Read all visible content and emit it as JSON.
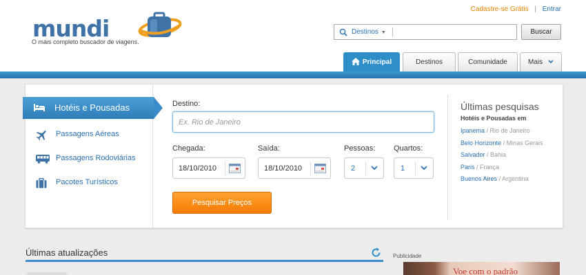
{
  "brand": {
    "name": "mundi",
    "tagline": "O mais completo buscador de viagens.",
    "color": "#3f72a6"
  },
  "toplinks": {
    "signup": "Cadastre-se Grátis",
    "separator": "|",
    "login": "Entrar"
  },
  "search": {
    "dropdown": "Destinos",
    "button": "Buscar"
  },
  "tabs": [
    {
      "label": "Principal",
      "active": true
    },
    {
      "label": "Destinos"
    },
    {
      "label": "Comunidade"
    },
    {
      "label": "Mais"
    }
  ],
  "categories": [
    {
      "label": "Hotéis e Pousadas",
      "icon": "bed-icon",
      "active": true
    },
    {
      "label": "Passagens Aéreas",
      "icon": "airplane-icon"
    },
    {
      "label": "Passagens Rodoviárias",
      "icon": "bus-icon"
    },
    {
      "label": "Pacotes Turísticos",
      "icon": "suitcase-icon"
    }
  ],
  "form": {
    "destino_label": "Destino:",
    "destino_placeholder": "Ex. Rio de Janeiro",
    "chegada_label": "Chegada:",
    "chegada_value": "18/10/2010",
    "saida_label": "Saída:",
    "saida_value": "18/10/2010",
    "pessoas_label": "Pessoas:",
    "pessoas_value": "2",
    "quartos_label": "Quartos:",
    "quartos_value": "1",
    "submit": "Pesquisar Preços"
  },
  "recent": {
    "title": "Últimas pesquisas",
    "subtitle": "Hotéis e Pousadas em",
    "items": [
      {
        "city": "Ipanema",
        "region": "/ Rio de Janeiro"
      },
      {
        "city": "Belo Horizonte",
        "region": "/ Minas Gerais"
      },
      {
        "city": "Salvador",
        "region": "/ Bahia"
      },
      {
        "city": "Paris",
        "region": "/ França"
      },
      {
        "city": "Buenos Aires",
        "region": "/ Argentina"
      }
    ]
  },
  "updates": {
    "title": "Últimas atualizações"
  },
  "ad": {
    "label": "Publicidade",
    "text": "Voe com o padrão"
  },
  "colors": {
    "accent": "#2e8ec7",
    "orange": "#f57b00",
    "link": "#2a6fb3"
  }
}
